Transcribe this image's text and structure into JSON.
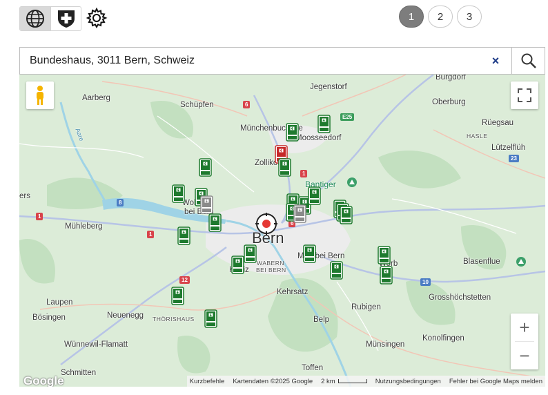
{
  "toolbar": {
    "map_mode_icons": [
      "globe-icon",
      "swiss-cross-icon"
    ],
    "settings_icon": "gear-icon"
  },
  "pager": {
    "pages": [
      "1",
      "2",
      "3"
    ],
    "active": "1"
  },
  "search": {
    "value": "Bundeshaus, 3011 Bern, Schweiz",
    "clear_label": "×",
    "search_icon": "search-icon"
  },
  "map": {
    "center_label": "Bern",
    "places": {
      "aarberg": "Aarberg",
      "schuepfen": "Schüpfen",
      "jegenstorf": "Jegenstorf",
      "burgdorf": "Burgdorf",
      "oberburg": "Oberburg",
      "ruegsau": "Rüegsau",
      "hasle": "HASLE",
      "luetzelflueh": "Lützelflüh",
      "muenchenbuchsee": "Münchenbuchsee",
      "moosseedorf": "Moosseedorf",
      "zollikofen": "Zollikofen",
      "bantiger": "Bantiger",
      "aare": "Aare",
      "ers": "ers",
      "muehleberg": "Mühleberg",
      "wohlen": "Wohlen",
      "bei_bern": "bei Bern",
      "muri": "Muri bei Bern",
      "worb": "Worb",
      "blasenflue": "Blasenflue",
      "wabern": "WABERN",
      "wabern2": "BEI BERN",
      "koeniz": "Köniz",
      "kehrsatz": "Kehrsatz",
      "rubigen": "Rubigen",
      "grosshoechstetten": "Grosshöchstetten",
      "laupen": "Laupen",
      "boesingen": "Bösingen",
      "neuenegg": "Neuenegg",
      "thorishaus": "THÖRISHAUS",
      "belp": "Belp",
      "konolfingen": "Konolfingen",
      "wuennewil": "Wünnewil-Flamatt",
      "schmitten": "Schmitten",
      "muensingen": "Münsingen",
      "toffen": "Toffen"
    },
    "road_shields": {
      "r6": "6",
      "r1a": "1",
      "r1b": "1",
      "r1c": "1",
      "r12": "12",
      "r10": "10",
      "r23": "23",
      "r8": "8",
      "e25": "E25",
      "r6b": "6"
    },
    "marker_colors": {
      "available": "#1e7a2e",
      "occupied": "#c62828",
      "unknown": "#8a8a8a"
    },
    "markers": [
      {
        "status": "available"
      },
      {
        "status": "available"
      },
      {
        "status": "occupied"
      },
      {
        "status": "available"
      },
      {
        "status": "available"
      },
      {
        "status": "available"
      },
      {
        "status": "available"
      },
      {
        "status": "unknown"
      },
      {
        "status": "available"
      },
      {
        "status": "available"
      },
      {
        "status": "available"
      },
      {
        "status": "available"
      },
      {
        "status": "available"
      },
      {
        "status": "available"
      },
      {
        "status": "unknown"
      },
      {
        "status": "available"
      },
      {
        "status": "available"
      },
      {
        "status": "available"
      },
      {
        "status": "available"
      },
      {
        "status": "available"
      },
      {
        "status": "available"
      },
      {
        "status": "available"
      },
      {
        "status": "available"
      },
      {
        "status": "available"
      },
      {
        "status": "available"
      },
      {
        "status": "available"
      }
    ],
    "controls": {
      "zoom_in": "+",
      "zoom_out": "−",
      "pegman_icon": "pegman-icon",
      "fullscreen_icon": "fullscreen-icon"
    },
    "footer": {
      "logo": "Google",
      "shortcuts": "Kurzbefehle",
      "mapdata": "Kartendaten ©2025 Google",
      "scale": "2 km",
      "terms": "Nutzungsbedingungen",
      "report": "Fehler bei Google Maps melden"
    }
  }
}
